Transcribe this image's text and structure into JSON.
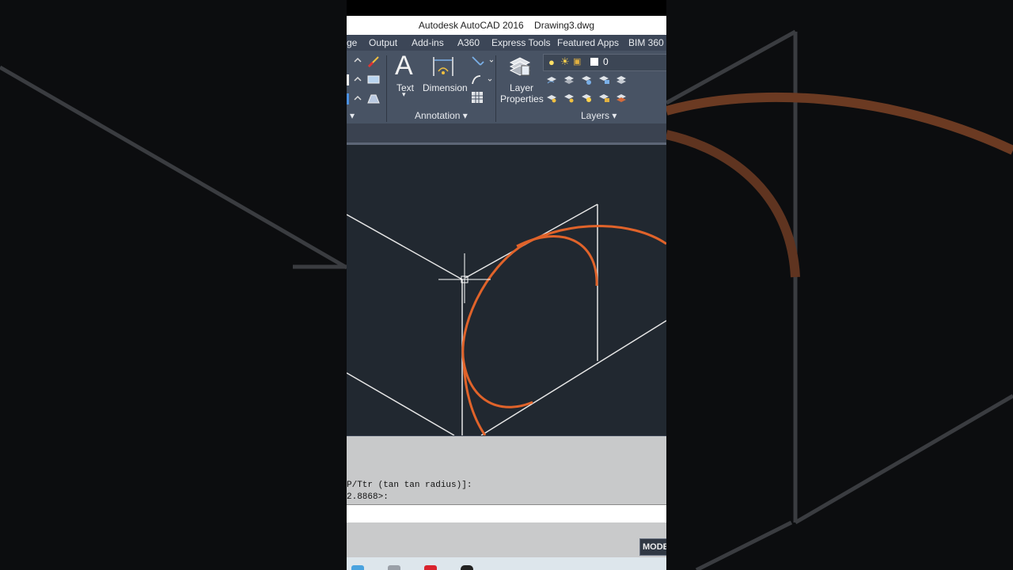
{
  "app": {
    "title": "Autodesk AutoCAD 2016",
    "document": "Drawing3.dwg"
  },
  "ribbon_tabs": [
    "ge",
    "Output",
    "Add-ins",
    "A360",
    "Express Tools",
    "Featured Apps",
    "BIM 360"
  ],
  "annotation_panel": {
    "label": "Annotation",
    "text_label": "Text",
    "dimension_label": "Dimension"
  },
  "layers_panel": {
    "label": "Layers",
    "layer_properties_line1": "Layer",
    "layer_properties_line2": "Properties",
    "current_layer": "0"
  },
  "command_history": [
    "P/Ttr (tan tan radius)]:",
    "2.8868>:"
  ],
  "status": {
    "model_label": "MODE"
  },
  "colors": {
    "viewport_bg": "#212830",
    "arc_color": "#e0632a",
    "line_color": "#e8e8e8",
    "ribbon_bg": "#485364"
  },
  "icons": [
    "lightbulb-icon",
    "sun-icon",
    "lock-icon",
    "color-swatch-icon",
    "text-icon",
    "dimension-icon",
    "layer-properties-icon",
    "table-icon",
    "leader-icon"
  ]
}
